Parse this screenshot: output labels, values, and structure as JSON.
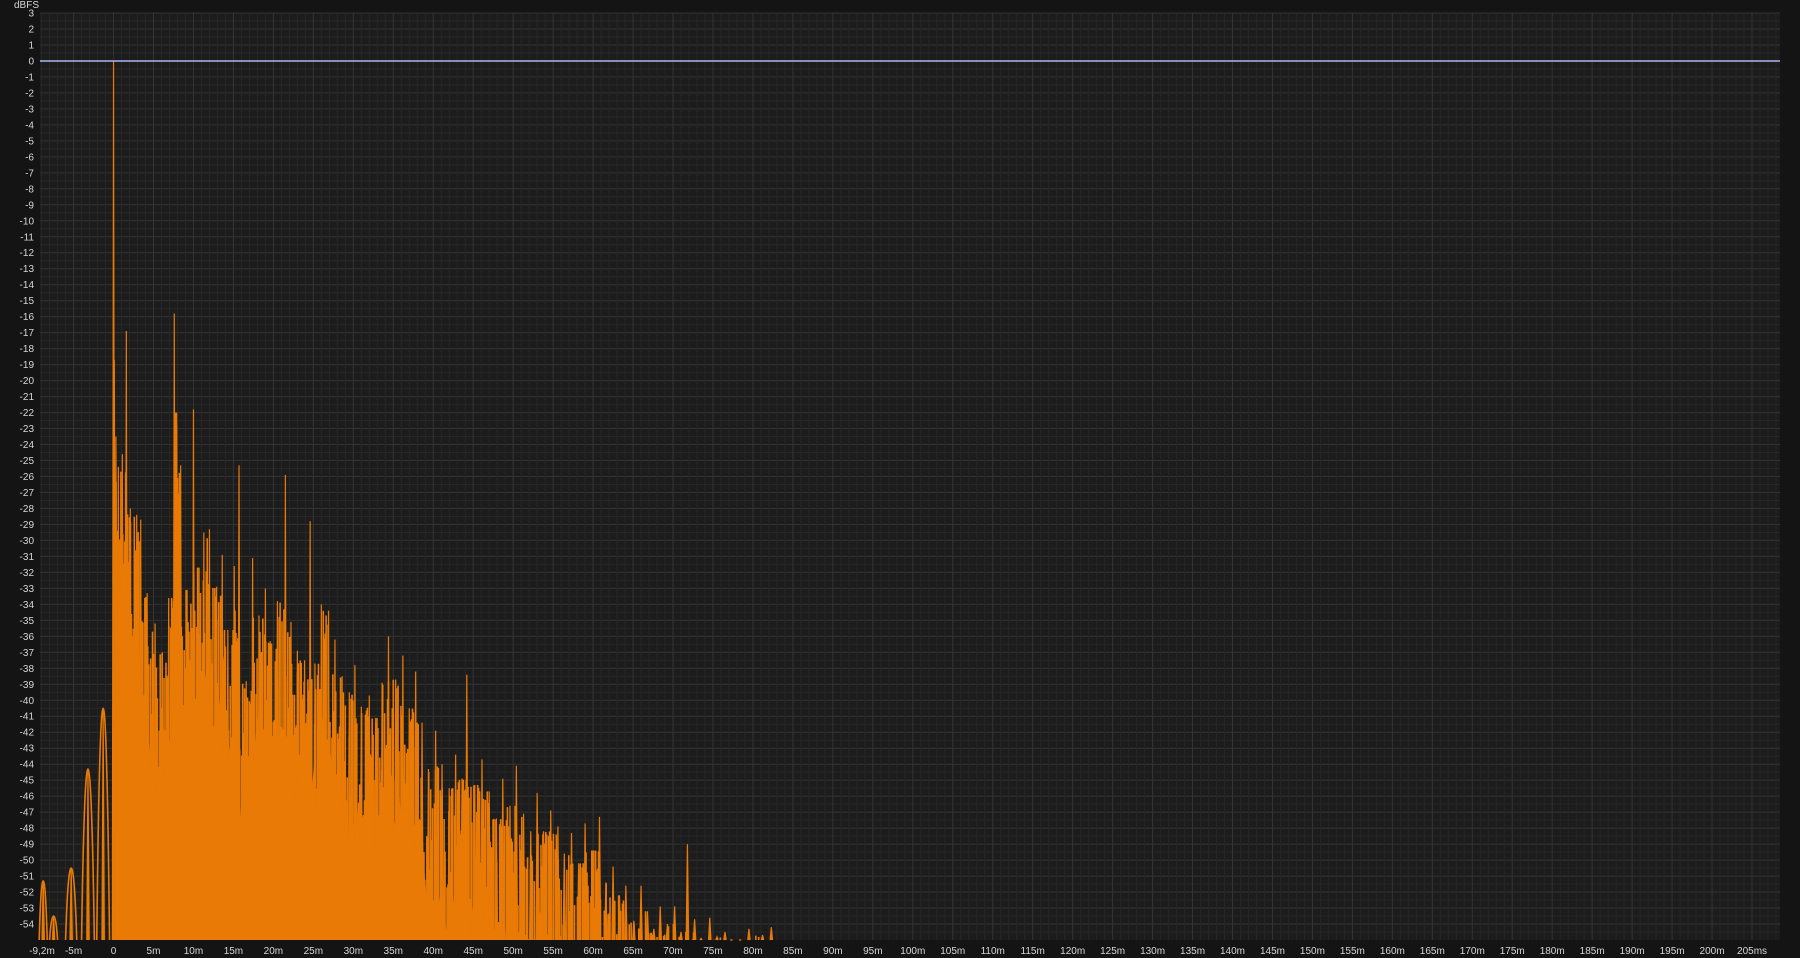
{
  "chart_data": {
    "type": "area",
    "title": "",
    "ylabel": "dBFS",
    "xlabel": "",
    "x_unit_suffix": "ms",
    "xlim": [
      -9.2,
      208.5
    ],
    "ylim": [
      -55,
      3
    ],
    "grid": true,
    "colors": {
      "background": "#141414",
      "plot_background": "#1c1c1c",
      "grid": "#343434",
      "response": "#e87a05",
      "reference_line": "#a6b8f0",
      "text": "#d6d6d6"
    },
    "y_ticks": [
      3,
      2,
      1,
      0,
      -1,
      -2,
      -3,
      -4,
      -5,
      -6,
      -7,
      -8,
      -9,
      -10,
      -11,
      -12,
      -13,
      -14,
      -15,
      -16,
      -17,
      -18,
      -19,
      -20,
      -21,
      -22,
      -23,
      -24,
      -25,
      -26,
      -27,
      -28,
      -29,
      -30,
      -31,
      -32,
      -33,
      -34,
      -35,
      -36,
      -37,
      -38,
      -39,
      -40,
      -41,
      -42,
      -43,
      -44,
      -45,
      -46,
      -47,
      -48,
      -49,
      -50,
      -51,
      -52,
      -53,
      -54
    ],
    "x_tick_labels": [
      "-9,2m",
      "-5m",
      "0",
      "5m",
      "10m",
      "15m",
      "20m",
      "25m",
      "30m",
      "35m",
      "40m",
      "45m",
      "50m",
      "55m",
      "60m",
      "65m",
      "70m",
      "75m",
      "80m",
      "85m",
      "90m",
      "95m",
      "100m",
      "105m",
      "110m",
      "115m",
      "120m",
      "125m",
      "130m",
      "135m",
      "140m",
      "145m",
      "150m",
      "155m",
      "160m",
      "165m",
      "170m",
      "175m",
      "180m",
      "185m",
      "190m",
      "195m",
      "200m",
      "205ms"
    ],
    "x_tick_values": [
      -9.2,
      -5,
      0,
      5,
      10,
      15,
      20,
      25,
      30,
      35,
      40,
      45,
      50,
      55,
      60,
      65,
      70,
      75,
      80,
      85,
      90,
      95,
      100,
      105,
      110,
      115,
      120,
      125,
      130,
      135,
      140,
      145,
      150,
      155,
      160,
      165,
      170,
      175,
      180,
      185,
      190,
      195,
      200,
      205
    ],
    "reference_line": {
      "y": 0
    },
    "series": [
      {
        "values_note": "impulse response envelope peaks in dBFS",
        "peaks": [
          [
            -8.8,
            -51.3
          ],
          [
            -7.5,
            -53.5
          ],
          [
            -5.3,
            -50.5
          ],
          [
            -3.2,
            -44.3
          ],
          [
            -1.3,
            -40.5
          ],
          [
            0.0,
            0.0
          ],
          [
            0.1,
            -18.7
          ],
          [
            0.3,
            -23.5
          ],
          [
            0.6,
            -25.4
          ],
          [
            1.1,
            -24.6
          ],
          [
            1.6,
            -16.9
          ],
          [
            2.1,
            -28.0
          ],
          [
            2.9,
            -28.4
          ],
          [
            3.4,
            -28.7
          ],
          [
            4.2,
            -33.3
          ],
          [
            5.2,
            -35.2
          ],
          [
            6.1,
            -37.0
          ],
          [
            6.9,
            -33.6
          ],
          [
            7.6,
            -15.8
          ],
          [
            7.9,
            -22.0
          ],
          [
            8.4,
            -25.3
          ],
          [
            9.2,
            -33.1
          ],
          [
            10.0,
            -21.8
          ],
          [
            10.7,
            -31.7
          ],
          [
            11.3,
            -29.5
          ],
          [
            12.0,
            -29.3
          ],
          [
            12.9,
            -32.9
          ],
          [
            13.6,
            -30.9
          ],
          [
            14.3,
            -35.6
          ],
          [
            15.1,
            -31.6
          ],
          [
            15.7,
            -25.3
          ],
          [
            16.6,
            -38.8
          ],
          [
            17.4,
            -31.1
          ],
          [
            18.2,
            -34.7
          ],
          [
            19.0,
            -33.0
          ],
          [
            19.6,
            -36.3
          ],
          [
            20.5,
            -33.8
          ],
          [
            21.5,
            -25.9
          ],
          [
            22.2,
            -35.1
          ],
          [
            23.0,
            -36.9
          ],
          [
            23.9,
            -37.5
          ],
          [
            24.6,
            -28.8
          ],
          [
            25.2,
            -37.7
          ],
          [
            26.0,
            -34.0
          ],
          [
            26.9,
            -34.4
          ],
          [
            27.7,
            -36.2
          ],
          [
            28.6,
            -38.5
          ],
          [
            29.5,
            -39.5
          ],
          [
            30.2,
            -37.8
          ],
          [
            31.0,
            -40.4
          ],
          [
            32.0,
            -39.7
          ],
          [
            32.8,
            -41.1
          ],
          [
            33.6,
            -38.9
          ],
          [
            34.4,
            -36.0
          ],
          [
            35.3,
            -38.7
          ],
          [
            36.2,
            -37.2
          ],
          [
            37.0,
            -40.5
          ],
          [
            37.8,
            -38.2
          ],
          [
            38.6,
            -41.4
          ],
          [
            39.4,
            -44.3
          ],
          [
            40.3,
            -41.9
          ],
          [
            41.1,
            -44.0
          ],
          [
            42.0,
            -45.5
          ],
          [
            42.8,
            -43.4
          ],
          [
            43.6,
            -44.9
          ],
          [
            44.2,
            -38.4
          ],
          [
            45.2,
            -45.3
          ],
          [
            46.1,
            -43.7
          ],
          [
            47.0,
            -45.7
          ],
          [
            47.9,
            -47.4
          ],
          [
            48.7,
            -44.9
          ],
          [
            49.6,
            -46.6
          ],
          [
            50.4,
            -44.1
          ],
          [
            51.3,
            -47.1
          ],
          [
            52.2,
            -48.2
          ],
          [
            53.0,
            -45.8
          ],
          [
            53.8,
            -48.2
          ],
          [
            54.7,
            -46.9
          ],
          [
            55.6,
            -47.9
          ],
          [
            56.4,
            -49.6
          ],
          [
            57.3,
            -48.3
          ],
          [
            58.2,
            -50.2
          ],
          [
            59.0,
            -47.7
          ],
          [
            59.9,
            -49.4
          ],
          [
            60.8,
            -47.3
          ],
          [
            61.6,
            -51.4
          ],
          [
            62.5,
            -50.4
          ],
          [
            63.3,
            -52.2
          ],
          [
            64.1,
            -51.6
          ],
          [
            65.1,
            -53.8
          ],
          [
            66.0,
            -51.6
          ],
          [
            66.8,
            -53.2
          ],
          [
            67.6,
            -54.3
          ],
          [
            68.4,
            -52.9
          ],
          [
            69.3,
            -54.0
          ],
          [
            70.2,
            -52.9
          ],
          [
            71.0,
            -54.5
          ],
          [
            71.8,
            -49.0
          ],
          [
            72.7,
            -53.7
          ],
          [
            73.5,
            -54.9
          ],
          [
            74.6,
            -53.6
          ],
          [
            75.5,
            -54.8
          ],
          [
            76.5,
            -54.5
          ],
          [
            77.3,
            -55.0
          ],
          [
            78.4,
            -55.0
          ],
          [
            79.5,
            -54.3
          ],
          [
            81.2,
            -54.7
          ],
          [
            82.3,
            -54.2
          ]
        ]
      }
    ]
  }
}
